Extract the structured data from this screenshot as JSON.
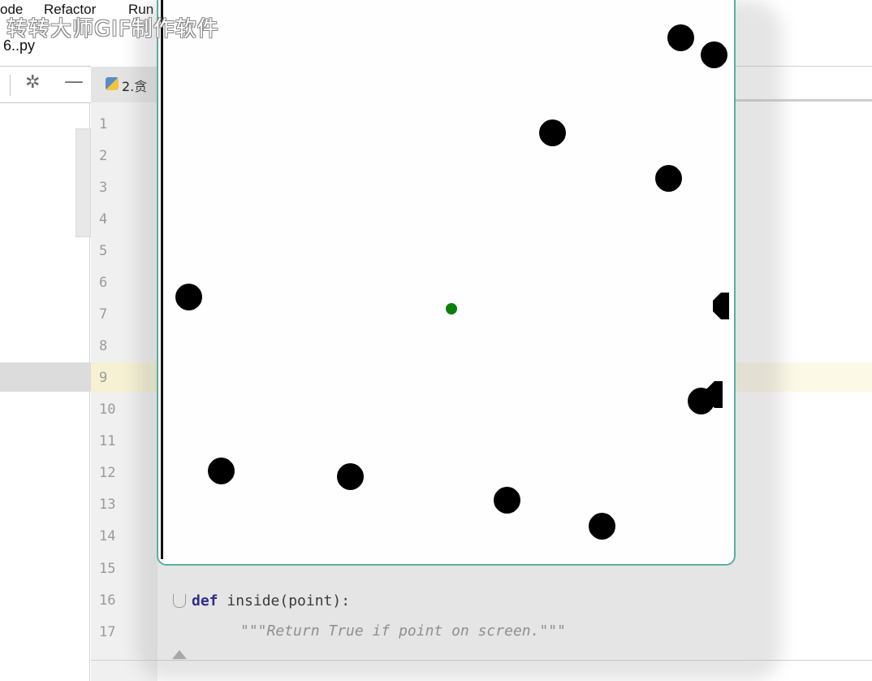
{
  "ide": {
    "menu": [
      "ode",
      "Refactor",
      "Run"
    ],
    "file_name": "6..py",
    "editor_tab": "2.贪",
    "line_numbers": [
      "1",
      "2",
      "3",
      "4",
      "5",
      "6",
      "7",
      "8",
      "9",
      "10",
      "11",
      "12",
      "13",
      "14",
      "15",
      "16",
      "17"
    ],
    "code": {
      "def_keyword": "def",
      "def_rest": " inside(point):",
      "docstring": "\"\"\"Return True if point on screen.\"\"\""
    }
  },
  "watermark": "转转大师GIF制作软件",
  "turtle_window": {
    "ball_color": "#000000",
    "player_color": "#0b7f0b",
    "border_color": "#5aaea0"
  },
  "icons": [
    "gear-icon",
    "minimize-icon",
    "python-file-icon"
  ]
}
